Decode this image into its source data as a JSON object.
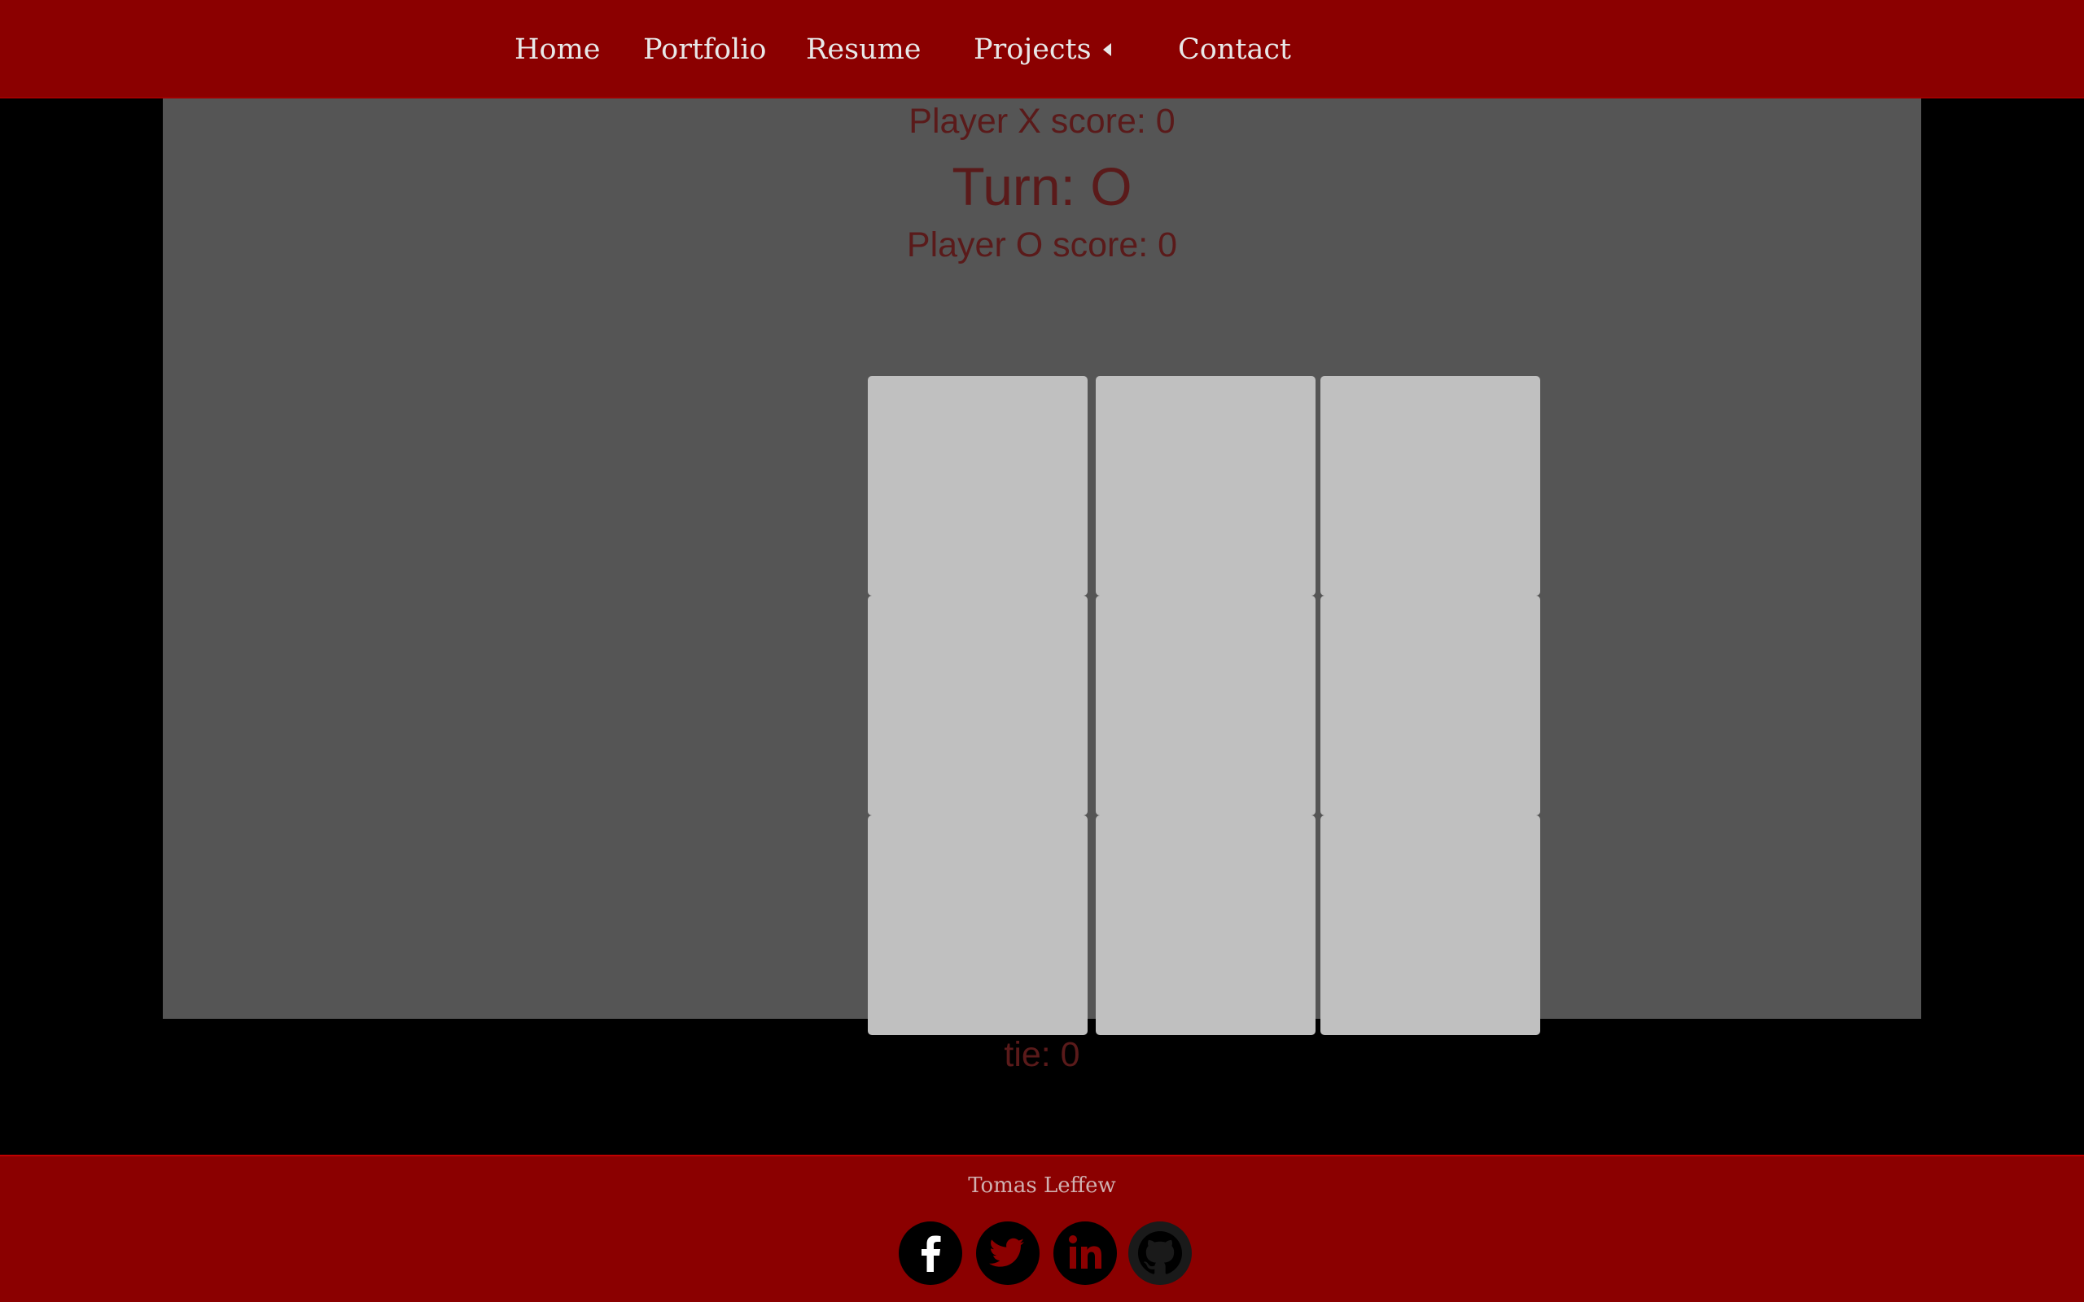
{
  "nav": {
    "items": [
      {
        "label": "Home"
      },
      {
        "label": "Portfolio"
      },
      {
        "label": "Resume"
      },
      {
        "label": "Projects"
      },
      {
        "label": "Contact"
      }
    ],
    "projects_dropdown_icon": "caret-left-icon"
  },
  "game": {
    "score_x": "Player X score: 0",
    "turn": "Turn: O",
    "score_o": "Player O score: 0",
    "tie": "tie: 0",
    "board": [
      "",
      "",
      "",
      "",
      "",
      "",
      "",
      "",
      ""
    ]
  },
  "footer": {
    "author": "Tomas Leffew",
    "social_icons": [
      "facebook-icon",
      "twitter-icon",
      "linkedin-icon",
      "github-icon"
    ]
  },
  "colors": {
    "nav_background": "#8b0000",
    "page_background": "#000000",
    "panel_background": "#555555",
    "cell_background": "#c0c0c0",
    "score_text": "#5a1a1a"
  }
}
